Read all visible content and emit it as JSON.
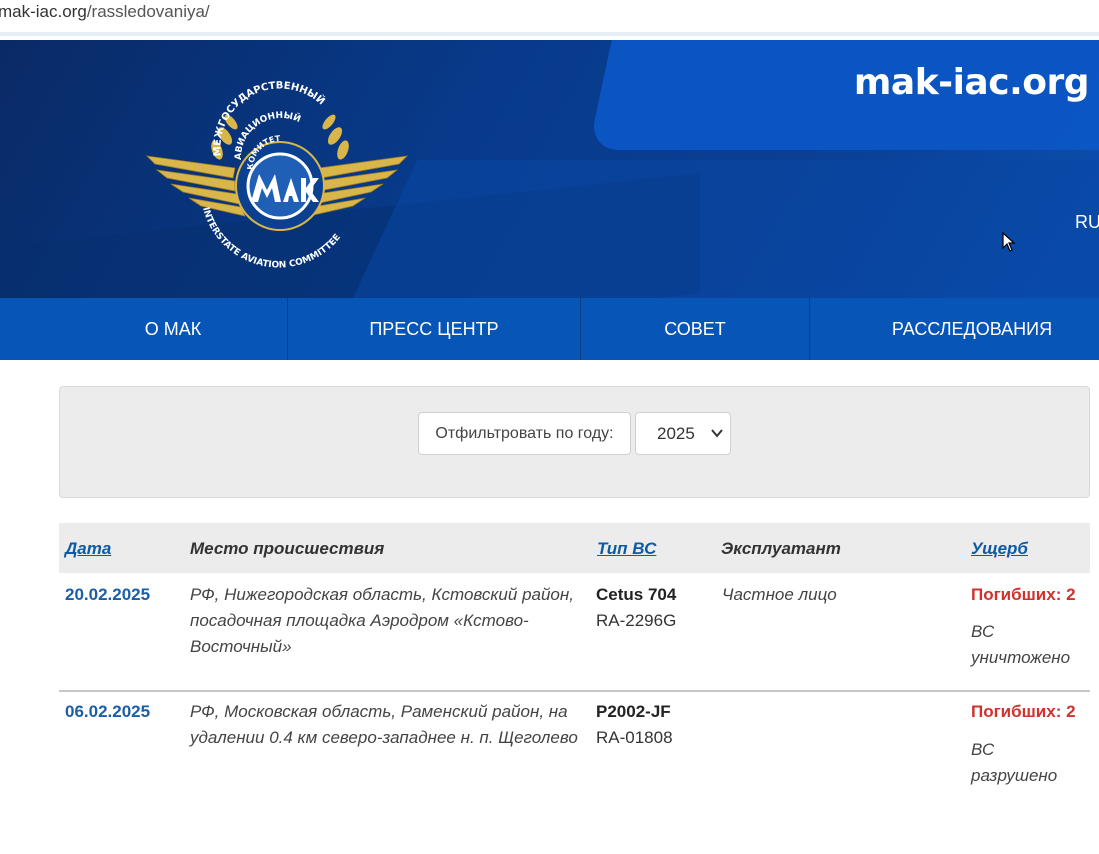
{
  "browser": {
    "url_host": "mak-iac.org",
    "url_path": "/rassledovaniya/"
  },
  "header": {
    "site_name": "mak-iac.org",
    "language": "RU",
    "logo": {
      "top_text": "МЕЖГОСУДАРСТВЕННЫЙ",
      "mid_text_1": "АВИАЦИОННЫЙ",
      "mid_text_2": "КОМИТЕТ",
      "bottom_text": "INTERSTATE AVIATION COMMITTEE"
    },
    "colors": {
      "dark_blue": "#0a2a66",
      "accent_blue": "#0b56c4",
      "gold": "#d8b64a"
    }
  },
  "nav": {
    "items": [
      {
        "label": "О МАК"
      },
      {
        "label": "ПРЕСС ЦЕНТР"
      },
      {
        "label": "СОВЕТ"
      },
      {
        "label": "РАССЛЕДОВАНИЯ"
      }
    ]
  },
  "filter": {
    "label": "Отфильтровать по году:",
    "selected_year": "2025"
  },
  "table": {
    "columns": {
      "date": "Дата",
      "place": "Место происшествия",
      "type": "Тип ВС",
      "operator": "Эксплуатант",
      "damage": "Ущерб"
    },
    "rows": [
      {
        "date": "20.02.2025",
        "place": "РФ, Нижегородская область, Кстовский район, посадочная площадка Аэродром «Кстово-Восточный»",
        "aircraft_type": "Cetus 704",
        "registration": "RA-2296G",
        "operator": "Частное лицо",
        "fatalities": "Погибших: 2",
        "damage": "ВС уничтожено"
      },
      {
        "date": "06.02.2025",
        "place": "РФ, Московская область, Раменский район, на удалении 0.4 км северо-западнее н. п. Щеголево",
        "aircraft_type": "P2002-JF",
        "registration": "RA-01808",
        "operator": "",
        "fatalities": "Погибших: 2",
        "damage": "ВС разрушено"
      }
    ]
  }
}
